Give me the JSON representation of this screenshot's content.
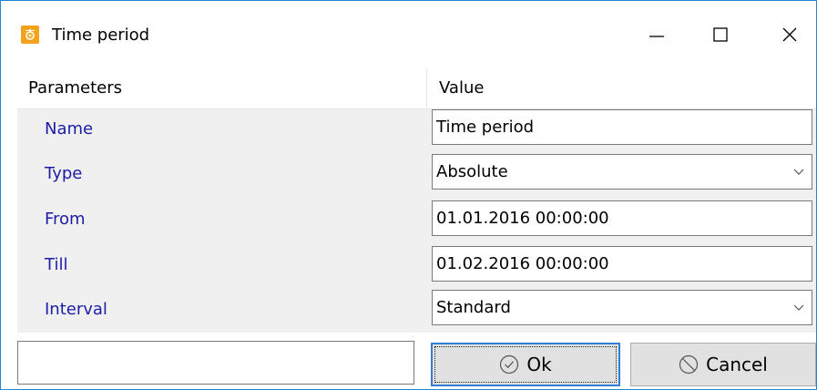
{
  "window": {
    "title": "Time period",
    "app_icon": "gear-app-icon",
    "controls": {
      "minimize_icon": "minimize-icon",
      "maximize_icon": "maximize-icon",
      "close_icon": "close-icon"
    }
  },
  "grid": {
    "headers": {
      "parameters": "Parameters",
      "value": "Value"
    },
    "rows": [
      {
        "label": "Name",
        "value": "Time period",
        "kind": "text"
      },
      {
        "label": "Type",
        "value": "Absolute",
        "kind": "dropdown"
      },
      {
        "label": "From",
        "value": "01.01.2016 00:00:00",
        "kind": "text"
      },
      {
        "label": "Till",
        "value": "01.02.2016 00:00:00",
        "kind": "text"
      },
      {
        "label": "Interval",
        "value": "Standard",
        "kind": "dropdown"
      }
    ]
  },
  "footer": {
    "input_value": "",
    "ok_label": "Ok",
    "ok_icon": "check-circle-icon",
    "cancel_label": "Cancel",
    "cancel_icon": "no-entry-icon"
  },
  "colors": {
    "label_blue": "#1c1ca8",
    "app_icon_orange": "#f3a21c",
    "focus_blue": "#2f7fd4",
    "window_border": "#1e88d8"
  }
}
